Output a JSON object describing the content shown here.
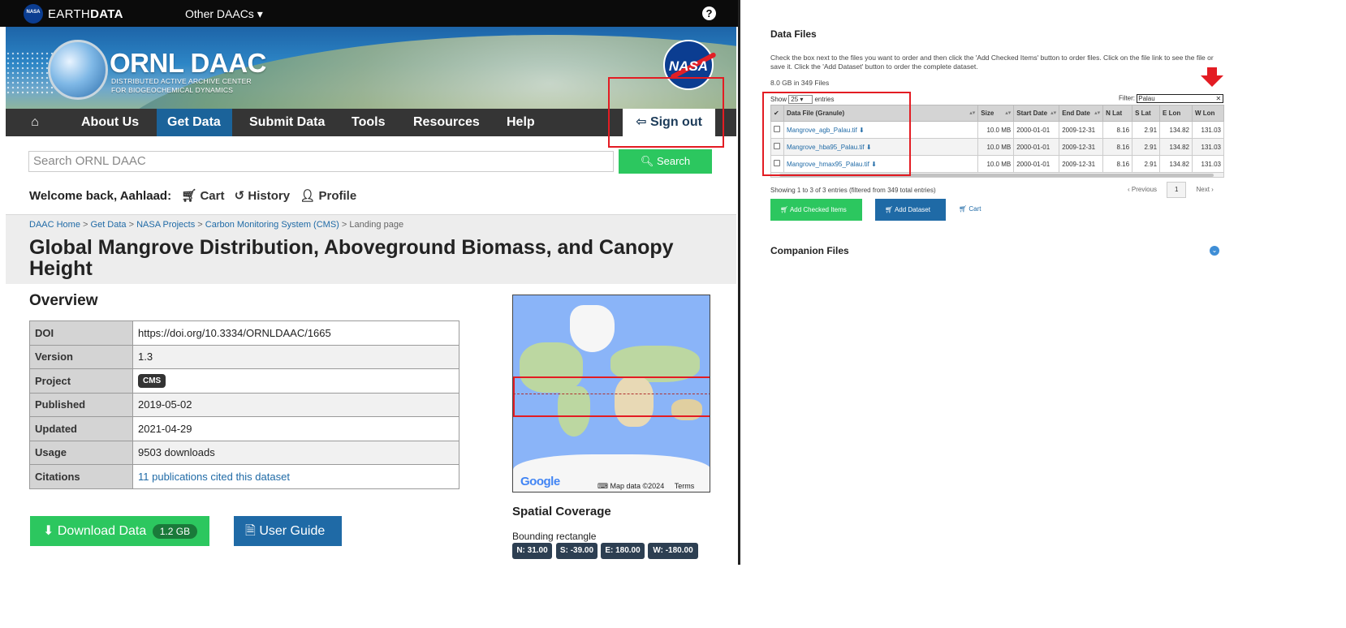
{
  "topbar": {
    "nasa_small": "NASA",
    "brand_a": "EARTH",
    "brand_b": "DATA",
    "other_daacs": "Other DAACs ▾",
    "help": "?"
  },
  "banner": {
    "title": "ORNL DAAC",
    "sub1": "DISTRIBUTED ACTIVE ARCHIVE CENTER",
    "sub2": "FOR BIOGEOCHEMICAL DYNAMICS",
    "nasa_logo": "NASA"
  },
  "nav": {
    "home_icon": "⌂",
    "items": [
      "About Us",
      "Get Data",
      "Submit Data",
      "Tools",
      "Resources",
      "Help"
    ],
    "sign_out": "Sign out"
  },
  "search": {
    "placeholder": "Search ORNL DAAC",
    "button": "Search"
  },
  "welcome": {
    "text": "Welcome back, Aahlaad:",
    "cart": "Cart",
    "history": "History",
    "profile": "Profile"
  },
  "breadcrumb": {
    "items": [
      "DAAC Home",
      "Get Data",
      "NASA Projects",
      "Carbon Monitoring System (CMS)"
    ],
    "current": "Landing page"
  },
  "page_title": "Global Mangrove Distribution, Aboveground Biomass, and Canopy Height",
  "overview": {
    "heading": "Overview",
    "rows": [
      {
        "key": "DOI",
        "value": "https://doi.org/10.3334/ORNLDAAC/1665"
      },
      {
        "key": "Version",
        "value": "1.3"
      },
      {
        "key": "Project",
        "value": "CMS"
      },
      {
        "key": "Published",
        "value": "2019-05-02"
      },
      {
        "key": "Updated",
        "value": "2021-04-29"
      },
      {
        "key": "Usage",
        "value": "9503 downloads"
      },
      {
        "key": "Citations",
        "value": "11 publications cited this dataset"
      }
    ]
  },
  "buttons": {
    "download": "Download Data",
    "download_size": "1.2 GB",
    "user_guide": "User Guide"
  },
  "map": {
    "google": "Google",
    "map_data": "Map data ©2024",
    "terms": "Terms"
  },
  "spatial": {
    "heading": "Spatial Coverage",
    "bbox_label": "Bounding rectangle",
    "n": "N: 31.00",
    "s": "S: -39.00",
    "e": "E: 180.00",
    "w": "W: -180.00"
  },
  "data_files": {
    "heading": "Data Files",
    "desc": "Check the box next to the files you want to order and then click the 'Add Checked Items' button to order files. Click on the file link to see the file or save it. Click the 'Add Dataset' button to order the complete dataset.",
    "size": "8.0 GB in 349 Files",
    "show_pre": "Show",
    "show_val": "25",
    "show_post": "entries",
    "filter_label": "Filter:",
    "filter_value": "Palau",
    "columns": [
      "✔",
      "Data File (Granule)",
      "Size",
      "Start Date",
      "End Date",
      "N Lat",
      "S Lat",
      "E Lon",
      "W Lon"
    ],
    "rows": [
      {
        "file": "Mangrove_agb_Palau.tif",
        "size": "10.0 MB",
        "start": "2000-01-01",
        "end": "2009-12-31",
        "n": "8.16",
        "s": "2.91",
        "e": "134.82",
        "w": "131.03"
      },
      {
        "file": "Mangrove_hba95_Palau.tif",
        "size": "10.0 MB",
        "start": "2000-01-01",
        "end": "2009-12-31",
        "n": "8.16",
        "s": "2.91",
        "e": "134.82",
        "w": "131.03"
      },
      {
        "file": "Mangrove_hmax95_Palau.tif",
        "size": "10.0 MB",
        "start": "2000-01-01",
        "end": "2009-12-31",
        "n": "8.16",
        "s": "2.91",
        "e": "134.82",
        "w": "131.03"
      }
    ],
    "showing": "Showing 1 to 3 of 3 entries (filtered from 349 total entries)",
    "prev": "‹ Previous",
    "page": "1",
    "next": "Next ›",
    "add_checked": "Add Checked Items",
    "add_dataset": "Add Dataset",
    "cart": "Cart"
  },
  "companion": {
    "heading": "Companion Files"
  },
  "colors": {
    "nav_bg": "#353535",
    "active_blue": "#1b639a",
    "green": "#2cc75f",
    "link_blue": "#1f6aa6",
    "annotation_red": "#e31c23"
  }
}
